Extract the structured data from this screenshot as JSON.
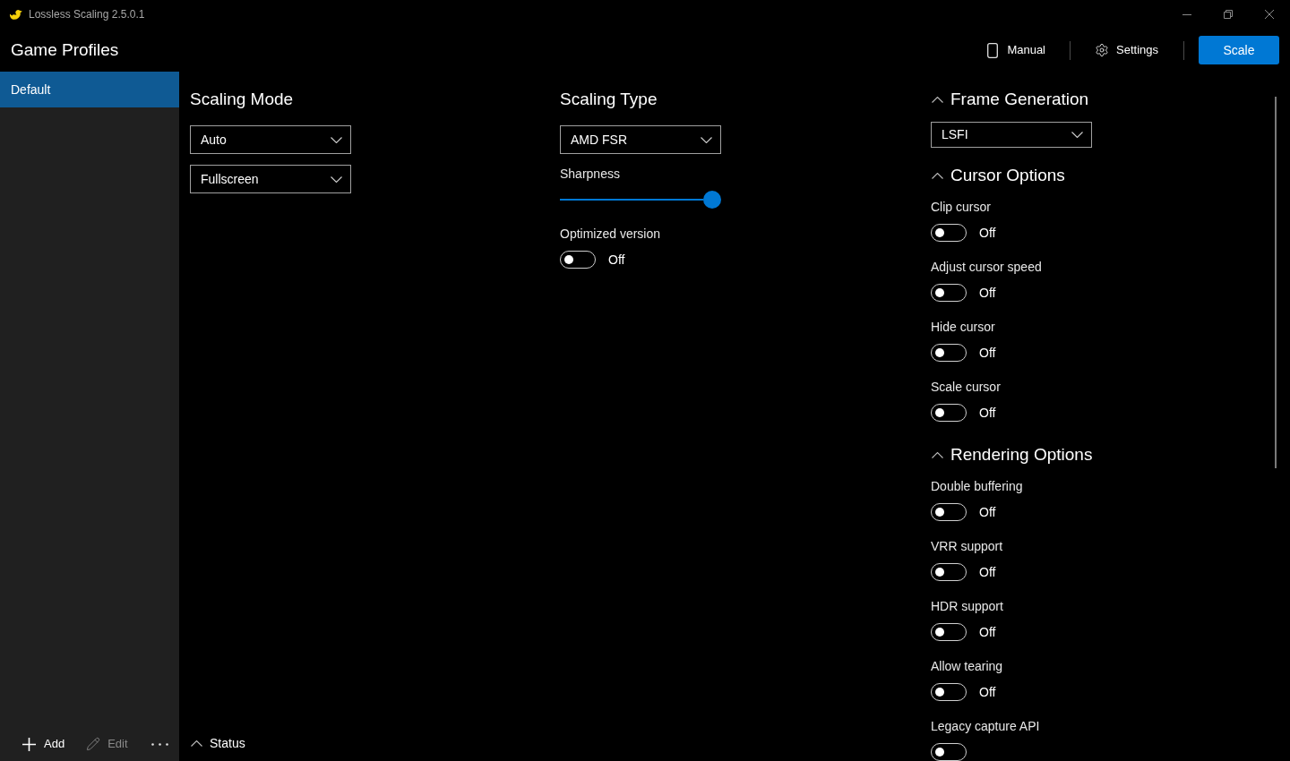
{
  "window": {
    "title": "Lossless Scaling 2.5.0.1"
  },
  "header": {
    "title": "Game Profiles",
    "actions": [
      {
        "kind": "manual",
        "label": "Manual"
      },
      {
        "kind": "settings",
        "label": "Settings"
      }
    ],
    "primary_button": {
      "label": "Scale"
    }
  },
  "sidebar": {
    "items": [
      {
        "label": "Default",
        "selected": true
      }
    ],
    "toolbar": [
      {
        "kind": "add",
        "label": "Add",
        "disabled": false
      },
      {
        "kind": "edit",
        "label": "Edit",
        "disabled": true
      },
      {
        "kind": "more"
      }
    ]
  },
  "scaling_mode": {
    "title": "Scaling Mode",
    "dropdowns": [
      {
        "value": "Auto"
      },
      {
        "value": "Fullscreen"
      }
    ]
  },
  "scaling_type": {
    "title": "Scaling Type",
    "dropdown": {
      "value": "AMD FSR"
    },
    "slider": {
      "label": "Sharpness",
      "level": 1
    },
    "toggle": {
      "label": "Optimized version",
      "on": false,
      "state_text": "Off"
    }
  },
  "frame_generation": {
    "title": "Frame Generation",
    "dropdown": {
      "value": "LSFI"
    }
  },
  "cursor_options": {
    "title": "Cursor Options",
    "toggles": [
      {
        "label": "Clip cursor",
        "on": false,
        "state_text": "Off"
      },
      {
        "label": "Adjust cursor speed",
        "on": false,
        "state_text": "Off"
      },
      {
        "label": "Hide cursor",
        "on": false,
        "state_text": "Off"
      },
      {
        "label": "Scale cursor",
        "on": false,
        "state_text": "Off"
      }
    ]
  },
  "rendering_options": {
    "title": "Rendering Options",
    "toggles": [
      {
        "label": "Double buffering",
        "on": false,
        "state_text": "Off"
      },
      {
        "label": "VRR support",
        "on": false,
        "state_text": "Off"
      },
      {
        "label": "HDR support",
        "on": false,
        "state_text": "Off"
      },
      {
        "label": "Allow tearing",
        "on": false,
        "state_text": "Off"
      },
      {
        "label": "Legacy capture API",
        "on": false
      }
    ]
  },
  "status": {
    "title": "Status"
  }
}
